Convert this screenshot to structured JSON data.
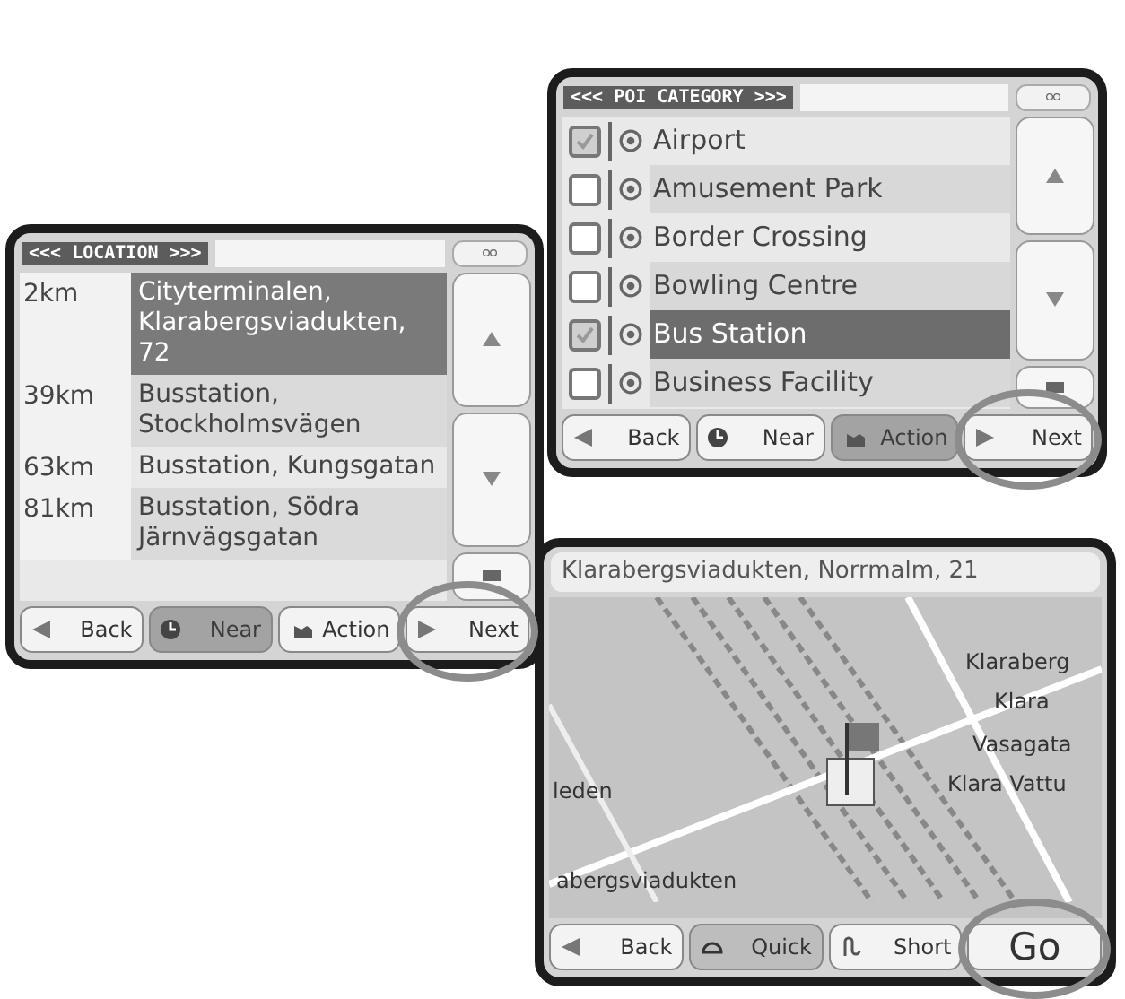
{
  "poi_screen": {
    "title": "<<< POI CATEGORY >>>",
    "items": [
      {
        "label": "Airport",
        "checked": true,
        "selected": false
      },
      {
        "label": "Amusement Park",
        "checked": false,
        "selected": false
      },
      {
        "label": "Border Crossing",
        "checked": false,
        "selected": false
      },
      {
        "label": "Bowling Centre",
        "checked": false,
        "selected": false
      },
      {
        "label": "Bus Station",
        "checked": true,
        "selected": true
      },
      {
        "label": "Business Facility",
        "checked": false,
        "selected": false
      }
    ],
    "buttons": [
      {
        "kind": "back",
        "label": "Back",
        "disabled": false,
        "highlighted": false
      },
      {
        "kind": "near",
        "label": "Near",
        "disabled": false,
        "highlighted": false
      },
      {
        "kind": "action",
        "label": "Action",
        "disabled": true,
        "highlighted": false
      },
      {
        "kind": "next",
        "label": "Next",
        "disabled": false,
        "highlighted": true
      }
    ]
  },
  "location_screen": {
    "title": "<<< LOCATION >>>",
    "results": [
      {
        "distance": "2km",
        "name": "Cityterminalen, Klarabergsviadukten, 72",
        "selected": true
      },
      {
        "distance": "39km",
        "name": "Busstation, Stockholmsvägen",
        "selected": false
      },
      {
        "distance": "63km",
        "name": "Busstation, Kungsgatan",
        "selected": false
      },
      {
        "distance": "81km",
        "name": "Busstation, Södra Järnvägsgatan",
        "selected": false
      }
    ],
    "buttons": [
      {
        "kind": "back",
        "label": "Back",
        "disabled": false,
        "highlighted": false
      },
      {
        "kind": "near",
        "label": "Near",
        "disabled": true,
        "highlighted": false
      },
      {
        "kind": "action",
        "label": "Action",
        "disabled": false,
        "highlighted": false
      },
      {
        "kind": "next",
        "label": "Next",
        "disabled": false,
        "highlighted": true
      }
    ]
  },
  "map_screen": {
    "address": "Klarabergsviadukten, Norrmalm, 21",
    "map_labels": [
      "Klaraberg",
      "Klara",
      "Vasagata",
      "Klara Vattu",
      "leden",
      "abergsviadukten"
    ],
    "buttons": [
      {
        "kind": "back",
        "label": "Back",
        "selected": false,
        "highlighted": false
      },
      {
        "kind": "quick",
        "label": "Quick",
        "selected": true,
        "highlighted": false
      },
      {
        "kind": "short",
        "label": "Short",
        "selected": false,
        "highlighted": false
      },
      {
        "kind": "go",
        "label": "Go",
        "selected": false,
        "highlighted": true
      }
    ]
  }
}
